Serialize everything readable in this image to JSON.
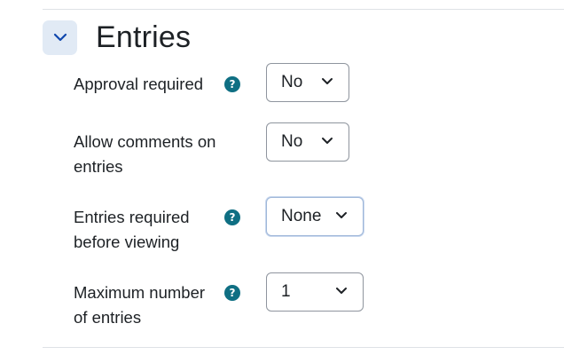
{
  "section": {
    "title": "Entries"
  },
  "fields": {
    "approval": {
      "label": "Approval required",
      "value": "No",
      "help": "?"
    },
    "comments": {
      "label": "Allow comments on entries",
      "value": "No"
    },
    "required_before_viewing": {
      "label": "Entries required before viewing",
      "value": "None",
      "help": "?"
    },
    "max_entries": {
      "label": "Maximum number of entries",
      "value": "1",
      "help": "?"
    }
  },
  "colors": {
    "help_icon": "#0f6f83",
    "collapse_bg": "#e1eaf5",
    "chevron_blue": "#0f47ad"
  }
}
